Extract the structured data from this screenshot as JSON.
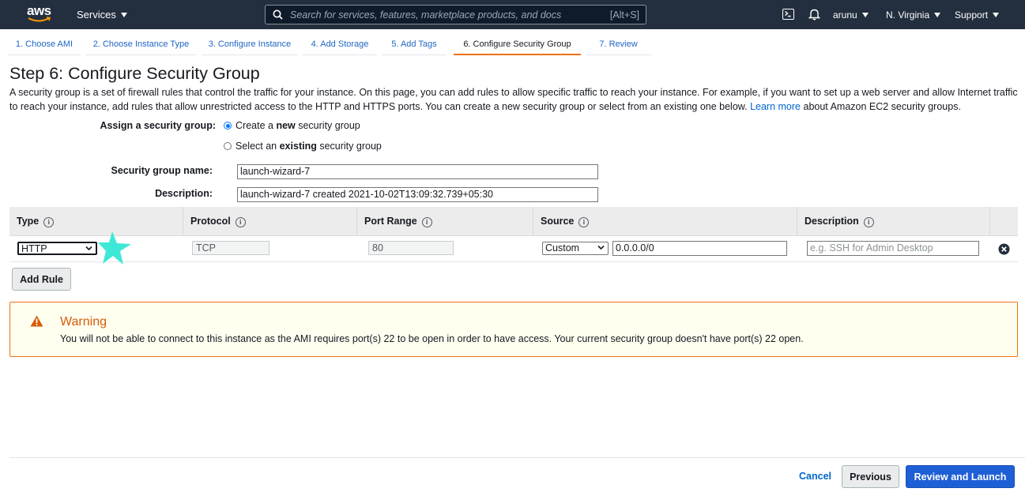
{
  "topnav": {
    "logo_text": "aws",
    "services_label": "Services",
    "search_placeholder": "Search for services, features, marketplace products, and docs",
    "search_shortcut": "[Alt+S]",
    "user": "arunu",
    "region": "N. Virginia",
    "support": "Support",
    "icons": [
      "cloudshell-icon",
      "bell-icon"
    ]
  },
  "wizard_tabs": [
    {
      "label": "1. Choose AMI"
    },
    {
      "label": "2. Choose Instance Type"
    },
    {
      "label": "3. Configure Instance"
    },
    {
      "label": "4. Add Storage"
    },
    {
      "label": "5. Add Tags"
    },
    {
      "label": "6. Configure Security Group",
      "active": true
    },
    {
      "label": "7. Review"
    }
  ],
  "page": {
    "title": "Step 6: Configure Security Group",
    "intro_text": "A security group is a set of firewall rules that control the traffic for your instance. On this page, you can add rules to allow specific traffic to reach your instance. For example, if you want to set up a web server and allow Internet traffic to reach your instance, add rules that allow unrestricted access to the HTTP and HTTPS ports. You can create a new security group or select from an existing one below.",
    "learn_more": "Learn more",
    "intro_suffix": "about Amazon EC2 security groups."
  },
  "form": {
    "assign_label": "Assign a security group:",
    "option_create_pre": "Create a",
    "option_create_bold": "new",
    "option_create_post": "security group",
    "option_existing_pre": "Select an",
    "option_existing_bold": "existing",
    "option_existing_post": "security group",
    "selected_option": "create",
    "name_label": "Security group name:",
    "name_value": "launch-wizard-7",
    "desc_label": "Description:",
    "desc_value": "launch-wizard-7 created 2021-10-02T13:09:32.739+05:30"
  },
  "rules_table": {
    "headers": [
      "Type",
      "Protocol",
      "Port Range",
      "Source",
      "Description"
    ],
    "rows": [
      {
        "type": "HTTP",
        "protocol": "TCP",
        "port_range": "80",
        "source_mode": "Custom",
        "source_cidr": "0.0.0.0/0",
        "description_placeholder": "e.g. SSH for Admin Desktop"
      }
    ],
    "add_rule_label": "Add Rule"
  },
  "warning": {
    "title": "Warning",
    "text": "You will not be able to connect to this instance as the AMI requires port(s) 22 to be open in order to have access. Your current security group doesn't have port(s) 22 open."
  },
  "footer": {
    "cancel": "Cancel",
    "previous": "Previous",
    "review_launch": "Review and Launch"
  },
  "colors": {
    "nav_bg": "#232f3e",
    "link": "#0066cc",
    "accent_orange": "#ec7211",
    "primary_button": "#1f5fd6",
    "annotation_star": "#3ee8d6"
  }
}
